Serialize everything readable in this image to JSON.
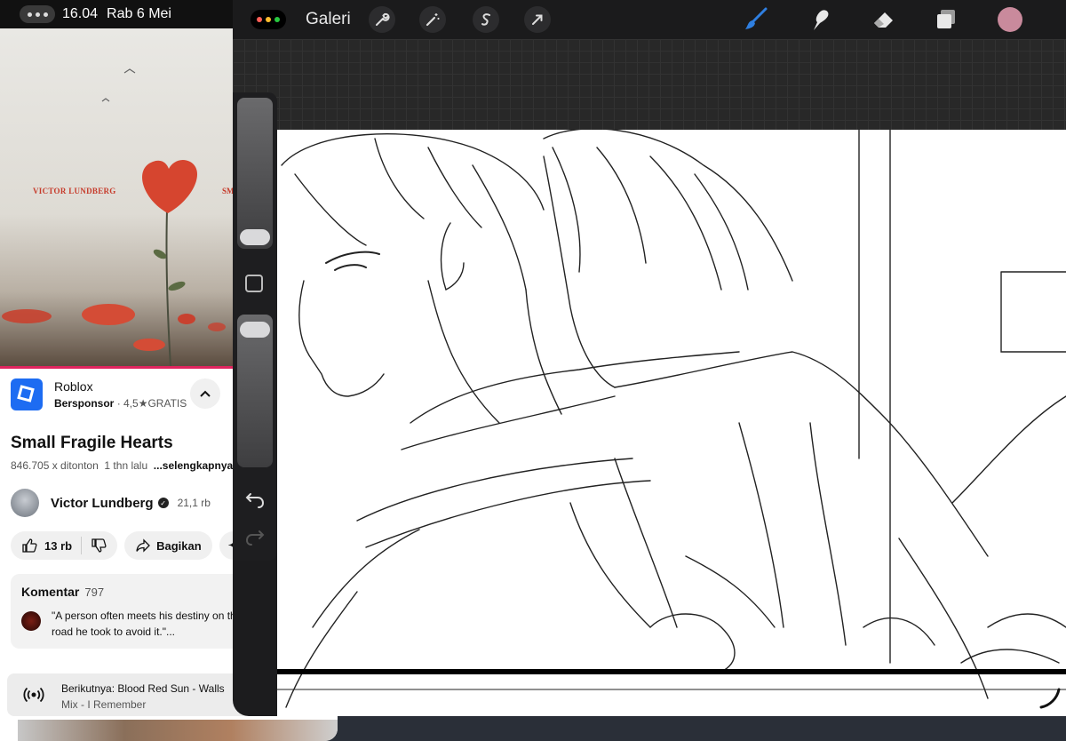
{
  "status_bar": {
    "time": "16.04",
    "date": "Rab 6 Mei"
  },
  "youtube": {
    "album_art": {
      "artist_text": "VICTOR LUNDBERG",
      "artist_text_cut": "SM"
    },
    "ad": {
      "app_name": "Roblox",
      "sponsored": "Bersponsor",
      "meta": "· 4,5★GRATIS"
    },
    "video": {
      "title": "Small Fragile Hearts",
      "views": "846.705 x ditonton",
      "age": "1 thn lalu",
      "more": "...selengkapnya"
    },
    "channel": {
      "name": "Victor Lundberg",
      "subscribers": "21,1 rb"
    },
    "actions": {
      "likes": "13 rb",
      "share": "Bagikan"
    },
    "comments": {
      "label": "Komentar",
      "count": "797",
      "top_comment": "\"A person often meets his destiny on the road he took to avoid it.\"..."
    },
    "up_next": {
      "prefix": "Berikutnya:",
      "title": "Blood Red Sun - Walls",
      "subtitle": "Mix - I Remember"
    }
  },
  "procreate": {
    "gallery_label": "Galeri",
    "colors": {
      "current_color": "#c98a9c",
      "brush_active": "#2f7fe0"
    },
    "left_tools": [
      "wrench-icon",
      "magic-wand-icon",
      "selection-icon",
      "transform-arrow-icon"
    ],
    "right_tools": [
      "brush-icon",
      "smudge-icon",
      "eraser-icon",
      "layers-icon"
    ]
  }
}
